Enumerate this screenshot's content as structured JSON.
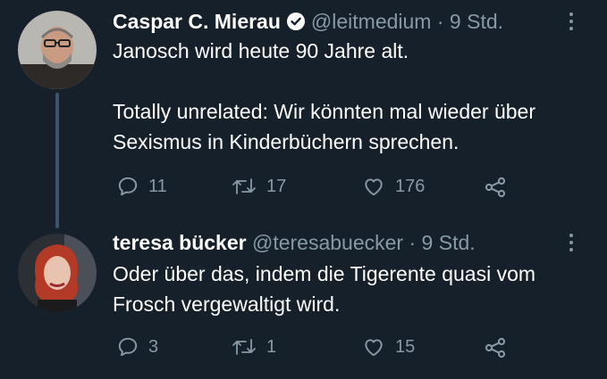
{
  "tweets": [
    {
      "name": "Caspar C. Mierau",
      "handle": "@leitmedium",
      "sep": "·",
      "time": "9 Std.",
      "verified": true,
      "lines": [
        "Janosch wird heute 90 Jahre alt.",
        "",
        "Totally unrelated: Wir könnten mal wieder über Sexismus in Kinderbüchern sprechen."
      ],
      "replies": "11",
      "retweets": "17",
      "likes": "176"
    },
    {
      "name": "teresa bücker",
      "handle": "@teresabuecker",
      "sep": "·",
      "time": "9 Std.",
      "verified": false,
      "lines": [
        "Oder über das, indem die Tigerente quasi vom Frosch vergewaltigt wird."
      ],
      "replies": "3",
      "retweets": "1",
      "likes": "15"
    }
  ],
  "colors": {
    "background": "#15202b",
    "text": "#ffffff",
    "muted": "#8899a6",
    "accent": "#1da1f2"
  }
}
